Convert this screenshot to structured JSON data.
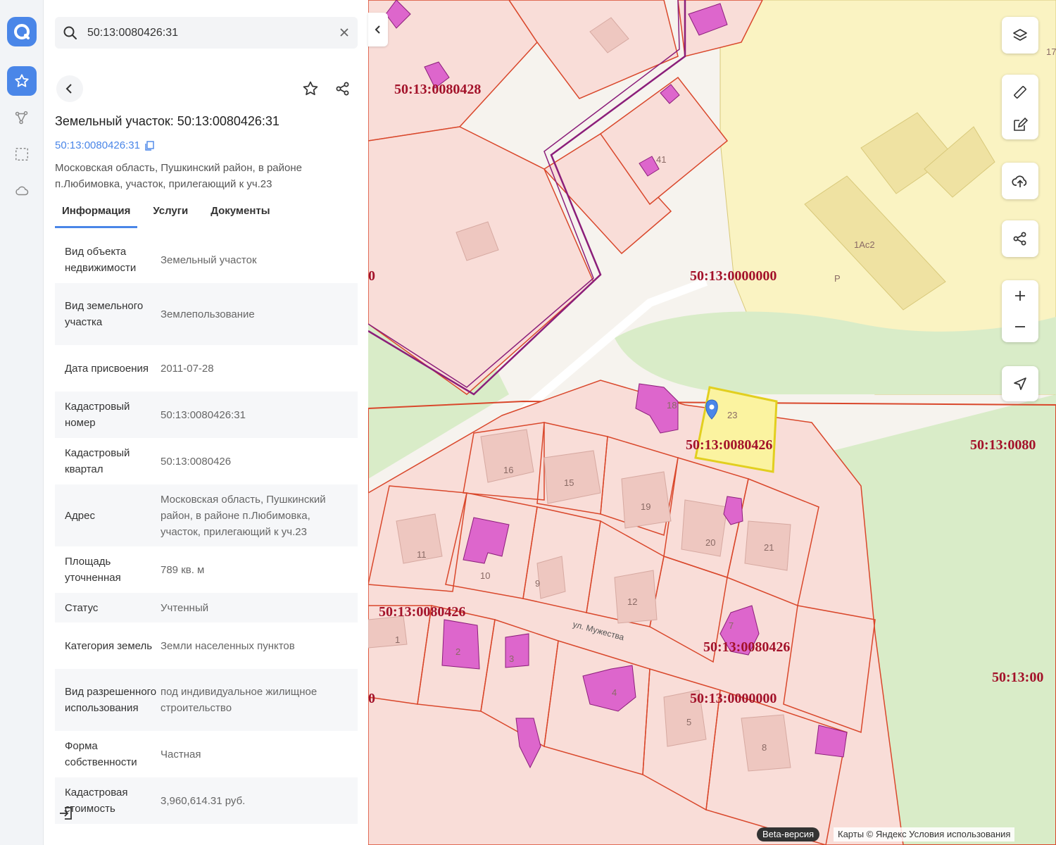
{
  "search": {
    "value": "50:13:0080426:31"
  },
  "parcel": {
    "title": "Земельный участок: 50:13:0080426:31",
    "cad_number": "50:13:0080426:31",
    "address": "Московская область, Пушкинский район, в районе п.Любимовка, участок, прилегающий к уч.23"
  },
  "tabs": [
    {
      "label": "Информация"
    },
    {
      "label": "Услуги"
    },
    {
      "label": "Документы"
    }
  ],
  "properties": [
    {
      "key": "Вид объекта недвижимости",
      "value": "Земельный участок"
    },
    {
      "key": "Вид земельного участка",
      "value": "Землепользование"
    },
    {
      "key": "Дата присвоения",
      "value": "2011-07-28"
    },
    {
      "key": "Кадастровый номер",
      "value": "50:13:0080426:31"
    },
    {
      "key": "Кадастровый квартал",
      "value": "50:13:0080426"
    },
    {
      "key": "Адрес",
      "value": "Московская область, Пушкинский район, в районе п.Любимовка, участок, прилегающий к уч.23"
    },
    {
      "key": "Площадь уточненная",
      "value": "789 кв. м"
    },
    {
      "key": "Статус",
      "value": "Учтенный"
    },
    {
      "key": "Категория земель",
      "value": "Земли населенных пунктов"
    },
    {
      "key": "Вид разрешенного использования",
      "value": "под индивидуальное жилищное строительство"
    },
    {
      "key": "Форма собственности",
      "value": "Частная"
    },
    {
      "key": "Кадастровая стоимость",
      "value": "3,960,614.31 руб."
    }
  ],
  "map": {
    "quarter_labels": [
      "50:13:0080428",
      "50:13:0000000",
      "50:13:0080426",
      "50:13:0080426",
      "50:13:0080426",
      "50:13:0000000",
      "50:13:0080",
      "50:13:00",
      "0",
      "0"
    ],
    "lot_numbers": [
      "16",
      "15",
      "19",
      "20",
      "21",
      "11",
      "10",
      "9",
      "12",
      "1",
      "2",
      "3",
      "4",
      "5",
      "8",
      "23",
      "18",
      "41",
      "7"
    ],
    "misc_labels": [
      "1Ас2",
      "Р",
      "17"
    ],
    "street": "ул. Мужества",
    "beta": "Beta-версия",
    "attribution": "Карты © Яндекс   Условия использования"
  },
  "colors": {
    "accent": "#4a86e8",
    "parcel_fill": "#f9ddd8",
    "parcel_stroke": "#d9472b",
    "building_fill": "#dd66cc",
    "quarter_label": "#a3122a",
    "selected_fill": "#fbf3a0",
    "forest": "#d9ecc8",
    "zone_yellow": "#faf3c2"
  }
}
